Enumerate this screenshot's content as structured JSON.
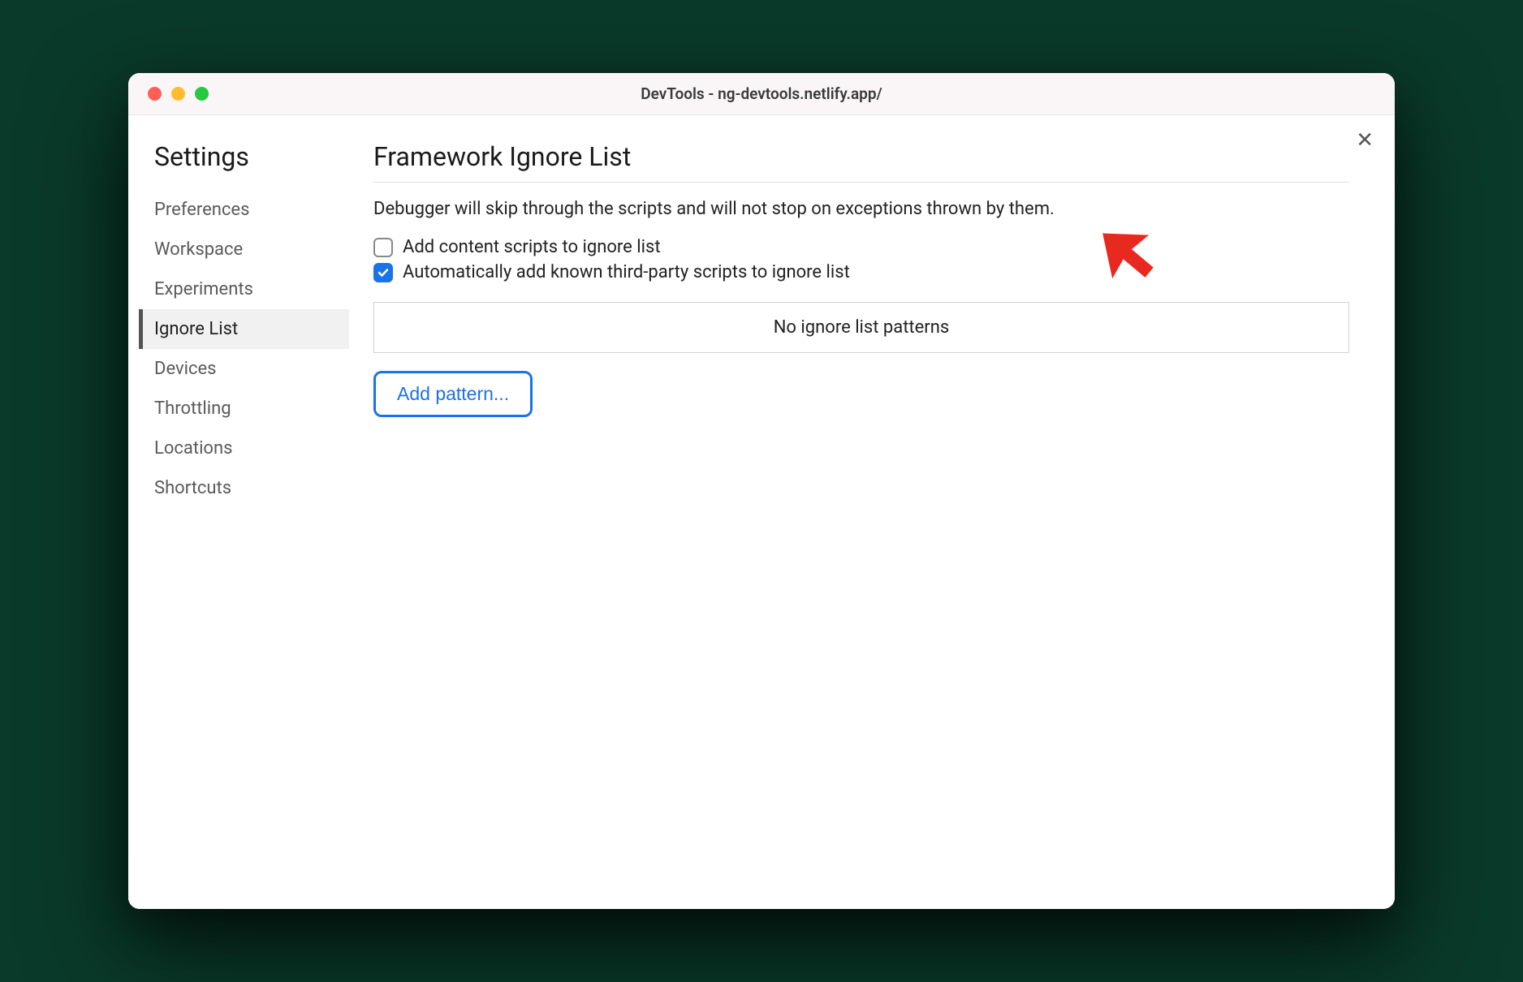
{
  "window": {
    "title": "DevTools - ng-devtools.netlify.app/"
  },
  "sidebar": {
    "title": "Settings",
    "items": [
      {
        "label": "Preferences",
        "active": false
      },
      {
        "label": "Workspace",
        "active": false
      },
      {
        "label": "Experiments",
        "active": false
      },
      {
        "label": "Ignore List",
        "active": true
      },
      {
        "label": "Devices",
        "active": false
      },
      {
        "label": "Throttling",
        "active": false
      },
      {
        "label": "Locations",
        "active": false
      },
      {
        "label": "Shortcuts",
        "active": false
      }
    ]
  },
  "main": {
    "title": "Framework Ignore List",
    "description": "Debugger will skip through the scripts and will not stop on exceptions thrown by them.",
    "checkboxes": [
      {
        "label": "Add content scripts to ignore list",
        "checked": false
      },
      {
        "label": "Automatically add known third-party scripts to ignore list",
        "checked": true
      }
    ],
    "empty_message": "No ignore list patterns",
    "add_button": "Add pattern..."
  },
  "close_label": "✕"
}
